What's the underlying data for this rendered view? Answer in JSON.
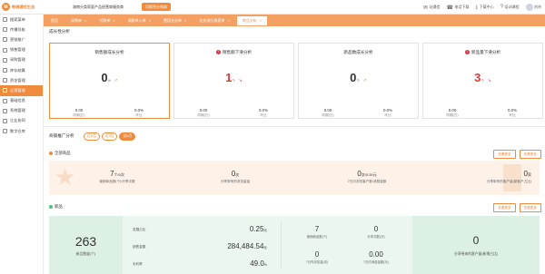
{
  "app": {
    "logo_mark": "M",
    "logo_text": "畅销通优生选"
  },
  "header": {
    "store": "湖南分类家庭产品经营商服务商",
    "switch_label": "切换到分销商",
    "items": [
      {
        "icon": "mail-icon",
        "glyph": "✉",
        "label": "站通信"
      },
      {
        "icon": "phone-icon",
        "glyph": "☎",
        "label": "电话下载"
      },
      {
        "icon": "download-icon",
        "glyph": "⤓",
        "label": "下载中心"
      },
      {
        "icon": "help-icon",
        "glyph": "?",
        "label": "培训课程"
      }
    ],
    "user": "刘舟"
  },
  "sidebar": {
    "items": [
      {
        "label": "搜索菜单"
      },
      {
        "label": "传播导航"
      },
      {
        "label": "营销推广"
      },
      {
        "label": "销售管理"
      },
      {
        "label": "采购管理"
      },
      {
        "label": "库存结算"
      },
      {
        "label": "资金管理"
      },
      {
        "label": "运营管理"
      },
      {
        "label": "基础信息"
      },
      {
        "label": "系统管理"
      },
      {
        "label": "企业协同"
      },
      {
        "label": "数字仓库"
      }
    ],
    "active_index": 7
  },
  "tabs": [
    {
      "label": "首页"
    },
    {
      "label": "采购单"
    },
    {
      "label": "付款单"
    },
    {
      "label": "调拨单入单"
    },
    {
      "label": "费用支出单"
    },
    {
      "label": "业务流行报表单"
    },
    {
      "label": "商品分析"
    }
  ],
  "growth": {
    "title": "成长性分析",
    "cards": [
      {
        "title": "销售额成长分析",
        "warn": false,
        "value": "0",
        "unit": "%",
        "left_value": "0.00",
        "left_label": "同期(万)",
        "right_value": "0.0%",
        "right_label": "环比",
        "red": false
      },
      {
        "title": "销售额下滑分析",
        "warn": true,
        "value": "1",
        "unit": "个",
        "left_value": "0.00",
        "left_label": "同期(万)",
        "right_value": "0.0%",
        "right_label": "环比",
        "red": true
      },
      {
        "title": "新品数成长分析",
        "warn": false,
        "value": "0",
        "unit": "个",
        "left_value": "0.00",
        "left_label": "同期(万)",
        "right_value": "0.0%",
        "right_label": "环比",
        "red": false
      },
      {
        "title": "新品量下滑分析",
        "warn": true,
        "value": "3",
        "unit": "个",
        "left_value": "0.00",
        "left_label": "同期(万)",
        "right_value": "0.0%",
        "right_label": "环比",
        "red": true
      }
    ]
  },
  "promo": {
    "title": "商铺推广分析",
    "filters": [
      {
        "label": "近1月"
      },
      {
        "label": "近3月"
      },
      {
        "label": "近6月"
      }
    ],
    "all_goods": {
      "title": "全部商品",
      "btn1": "查看更多",
      "btn2": "查看更多",
      "stats": [
        {
          "value": "7",
          "unit": "个/0次",
          "label": "营销商品数(个)/分享次数"
        },
        {
          "value": "0",
          "unit": "次",
          "label": "分享带来的浏览量量"
        },
        {
          "value": "0",
          "unit": "次/0.00元",
          "label": "7日内浏览客户数/消费金额"
        },
        {
          "value": "0",
          "unit": "家",
          "label": "分享带来的客户量(新客户占比)"
        }
      ]
    },
    "new_goods": {
      "title": "新品",
      "btn1": "查看更多",
      "btn2": "查看更多",
      "count": "263",
      "count_label": "新品数量(个)",
      "metrics": [
        {
          "label": "发展占比",
          "value": "0.25",
          "unit": "元"
        },
        {
          "label": "销售金额",
          "value": "284,484.54",
          "unit": "元"
        },
        {
          "label": "毛利率",
          "value": "49.0",
          "unit": "%"
        }
      ],
      "grid": [
        {
          "value": "7",
          "label": "营销新品数(个)"
        },
        {
          "value": "0",
          "label": "分享次数(次)"
        },
        {
          "value": "0",
          "label": "7日内浏览量(次)"
        },
        {
          "value": "0.00",
          "label": "7日内消费金额(元)"
        }
      ],
      "right_value": "0",
      "right_label": "分享带来的客户量(新增占比)"
    }
  }
}
